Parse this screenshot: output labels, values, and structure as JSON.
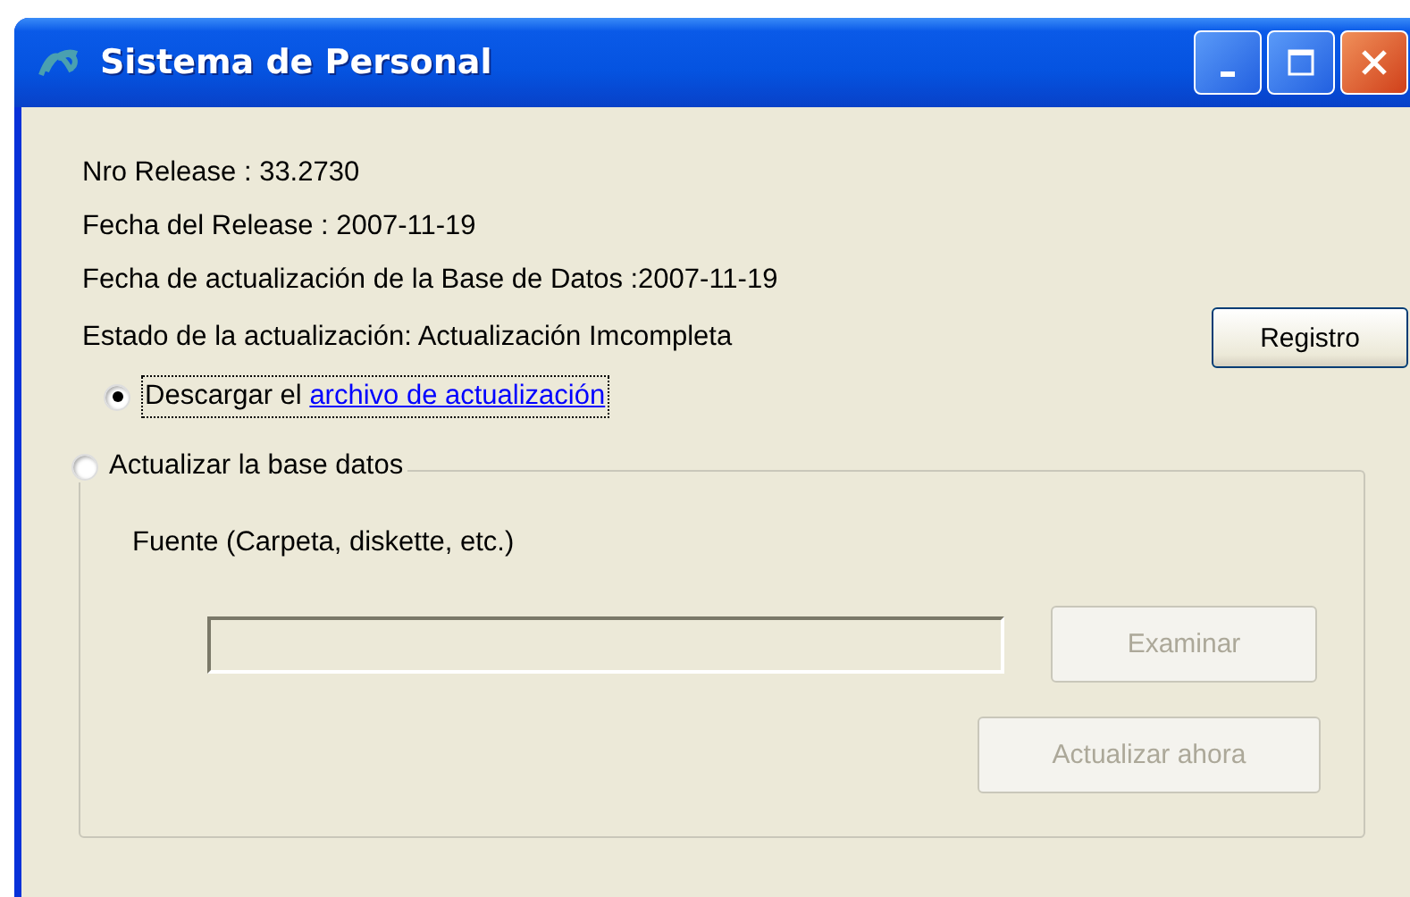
{
  "window": {
    "title": "Sistema de Personal"
  },
  "info_lines": [
    "Nro Release : 33.2730",
    "Fecha del Release : 2007-11-19",
    "Fecha de actualización de la Base de Datos :2007-11-19",
    "Estado de la actualización:  Actualización Imcompleta"
  ],
  "registro_button": {
    "label": "Registro",
    "disabled": false
  },
  "options": [
    {
      "label": "Descargar el ",
      "link": "archivo de actualización",
      "selected": true
    },
    {
      "label": "Actualizar la base datos",
      "selected": false
    }
  ],
  "source": {
    "label": "Fuente (Carpeta, diskette, etc.)",
    "disabled": true
  },
  "buttons": [
    {
      "label": "Examinar",
      "disabled": true
    },
    {
      "label": "Actualizar ahora",
      "disabled": true
    }
  ]
}
